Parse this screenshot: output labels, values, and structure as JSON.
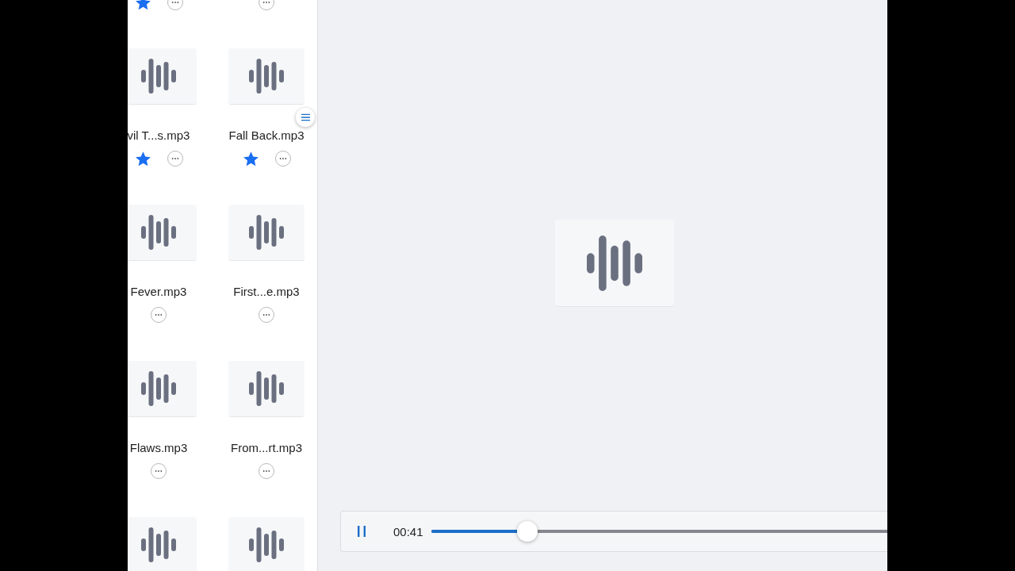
{
  "file_grid": {
    "rows": [
      [
        {
          "kind": "actions-only",
          "starred": true
        },
        {
          "kind": "actions-only",
          "starred": false
        }
      ],
      [
        {
          "kind": "full",
          "name": "vil T...s.mp3",
          "starred": true
        },
        {
          "kind": "full",
          "name": "Fall Back.mp3",
          "starred": true
        }
      ],
      [
        {
          "kind": "full",
          "name": "Fever.mp3",
          "starred": false
        },
        {
          "kind": "full",
          "name": "First...e.mp3",
          "starred": false
        }
      ],
      [
        {
          "kind": "full",
          "name": "Flaws.mp3",
          "starred": false
        },
        {
          "kind": "full",
          "name": "From...rt.mp3",
          "starred": false
        }
      ],
      [
        {
          "kind": "thumb-only"
        },
        {
          "kind": "thumb-only"
        }
      ]
    ]
  },
  "player": {
    "playing": true,
    "elapsed": "00:41",
    "level": 0.2
  }
}
